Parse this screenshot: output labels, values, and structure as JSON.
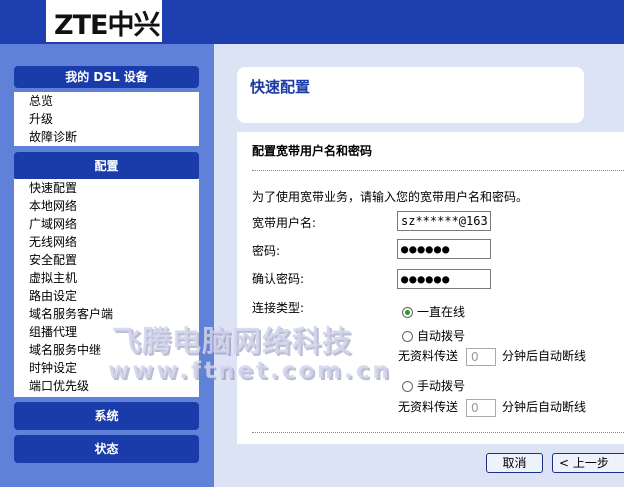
{
  "brand": {
    "logo_text": "ZTE中兴"
  },
  "sidebar": {
    "sections": [
      {
        "title": "我的 DSL 设备",
        "items": [
          "总览",
          "升级",
          "故障诊断"
        ]
      },
      {
        "title": "配置",
        "items": [
          "快速配置",
          "本地网络",
          "广域网络",
          "无线网络",
          "安全配置",
          "虚拟主机",
          "路由设定",
          "域名服务客户端",
          "组播代理",
          "域名服务中继",
          "时钟设定",
          "端口优先级"
        ]
      },
      {
        "title": "系统",
        "items": []
      },
      {
        "title": "状态",
        "items": []
      }
    ]
  },
  "main": {
    "page_title": "快速配置",
    "section_title": "配置宽带用户名和密码",
    "intro": "为了使用宽带业务，请输入您的宽带用户名和密码。",
    "username_label": "宽带用户名:",
    "username_value": "sz******@163.",
    "password_label": "密码:",
    "password_value": "●●●●●●",
    "confirm_label": "确认密码:",
    "confirm_value": "●●●●●●",
    "conn_type_label": "连接类型:",
    "options": [
      "一直在线",
      "自动拨号",
      "手动拨号"
    ],
    "selected_option": "一直在线",
    "idle_prefix": "无资料传送",
    "idle_value": "0",
    "idle_suffix": "分钟后自动断线",
    "cancel_label": "取消",
    "back_label": "< 上一步"
  },
  "watermark": {
    "line1": "飞腾电脑网络科技",
    "line2": "www.ftnet.com.cn"
  }
}
